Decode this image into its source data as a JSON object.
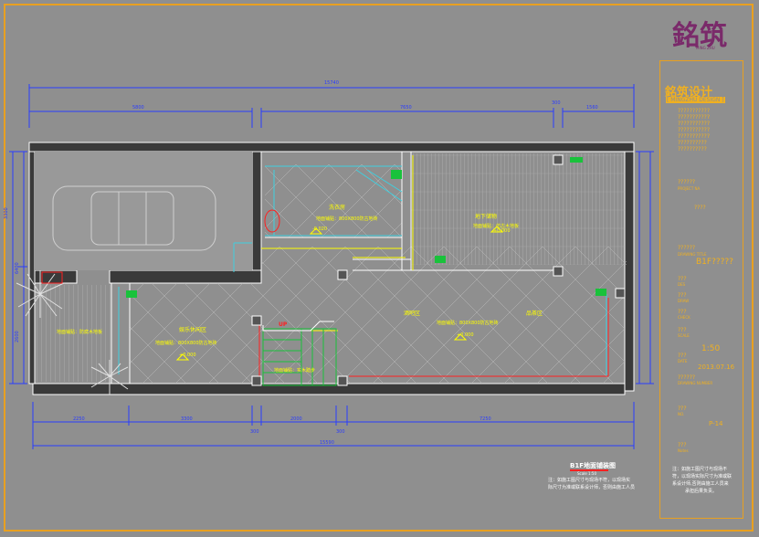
{
  "logo": {
    "text": "銘筑",
    "sub": "MING ZHU"
  },
  "title_block": {
    "company": "銘筑设计",
    "company_en": "[ MINGZHU DESIGN ]",
    "company_lines": [
      "???????????",
      "???????????",
      "???????????",
      "???????????",
      "???????????",
      "??????????",
      "??????????"
    ],
    "project_label": "??????",
    "project_label_en": "PROJECT NA",
    "project_value": "????",
    "drawing_label": "??????",
    "drawing_label_en": "DRAWING TITLE",
    "drawing_value": "B1F?????",
    "rows": [
      {
        "label": "???",
        "label_en": "DES",
        "value": ""
      },
      {
        "label": "???",
        "label_en": "DRAW",
        "value": ""
      },
      {
        "label": "???",
        "label_en": "CHECK",
        "value": ""
      },
      {
        "label": "???",
        "label_en": "SCALE",
        "value": "1:50"
      },
      {
        "label": "???",
        "label_en": "DATE",
        "value": "2013.07.16"
      },
      {
        "label": "??????",
        "label_en": "DRAWING NUMBER",
        "value": ""
      },
      {
        "label": "???",
        "label_en": "NO.",
        "value": "P-14"
      },
      {
        "label": "???",
        "label_en": "Notes",
        "value": ""
      }
    ],
    "note": [
      "注：如施工图尺寸与现场不",
      "符，以现场实际尺寸为准或联",
      "系设计师,否则由施工人员来",
      "承担后果负责。"
    ]
  },
  "drawing": {
    "dims_top": {
      "overall": "15740",
      "left": "5800",
      "mid": "7650",
      "small": "300",
      "right": "1560"
    },
    "dims_bottom": {
      "overall": "15590",
      "d1": "2250",
      "d2": "3300",
      "d3": "300",
      "d4": "2000",
      "d5": "300",
      "d6": "7250"
    },
    "dims_left": {
      "d1": "3300",
      "d2": "6400",
      "d3": "2600"
    },
    "rooms": [
      {
        "name": "娱乐休闲区",
        "finish": "地面铺贴：800X800防古地砖",
        "elev": "+0.000"
      },
      {
        "name": "洗衣房",
        "finish": "地面铺贴：800X800防古地砖",
        "elev": "-0.020"
      },
      {
        "name": "地下储物",
        "finish": "地面铺贴：仿古木地板",
        "elev": "+0.000"
      },
      {
        "name": "酒吧区",
        "finish": "地面铺贴：800X800防古地砖",
        "elev": "+0.000"
      },
      {
        "name": "品茶区",
        "finish": "",
        "elev": ""
      }
    ],
    "sub_labels": {
      "garden": "地面铺贴：防腐木地板",
      "stair": "地面铺贴：实木踏步",
      "up": "UP"
    },
    "title": "B1F地面铺装图",
    "scale": "Scale  1:50",
    "note": [
      "注：如施工图尺寸与现场不符，以现场实",
      "际尺寸为准或联系设计师，否则由施工人员"
    ]
  },
  "colors": {
    "frame": "#e8a020",
    "wall": "#ffffff",
    "dim": "#2a3cff",
    "text": "#ffff00",
    "accent": "#ff2020",
    "green": "#19c23b"
  }
}
